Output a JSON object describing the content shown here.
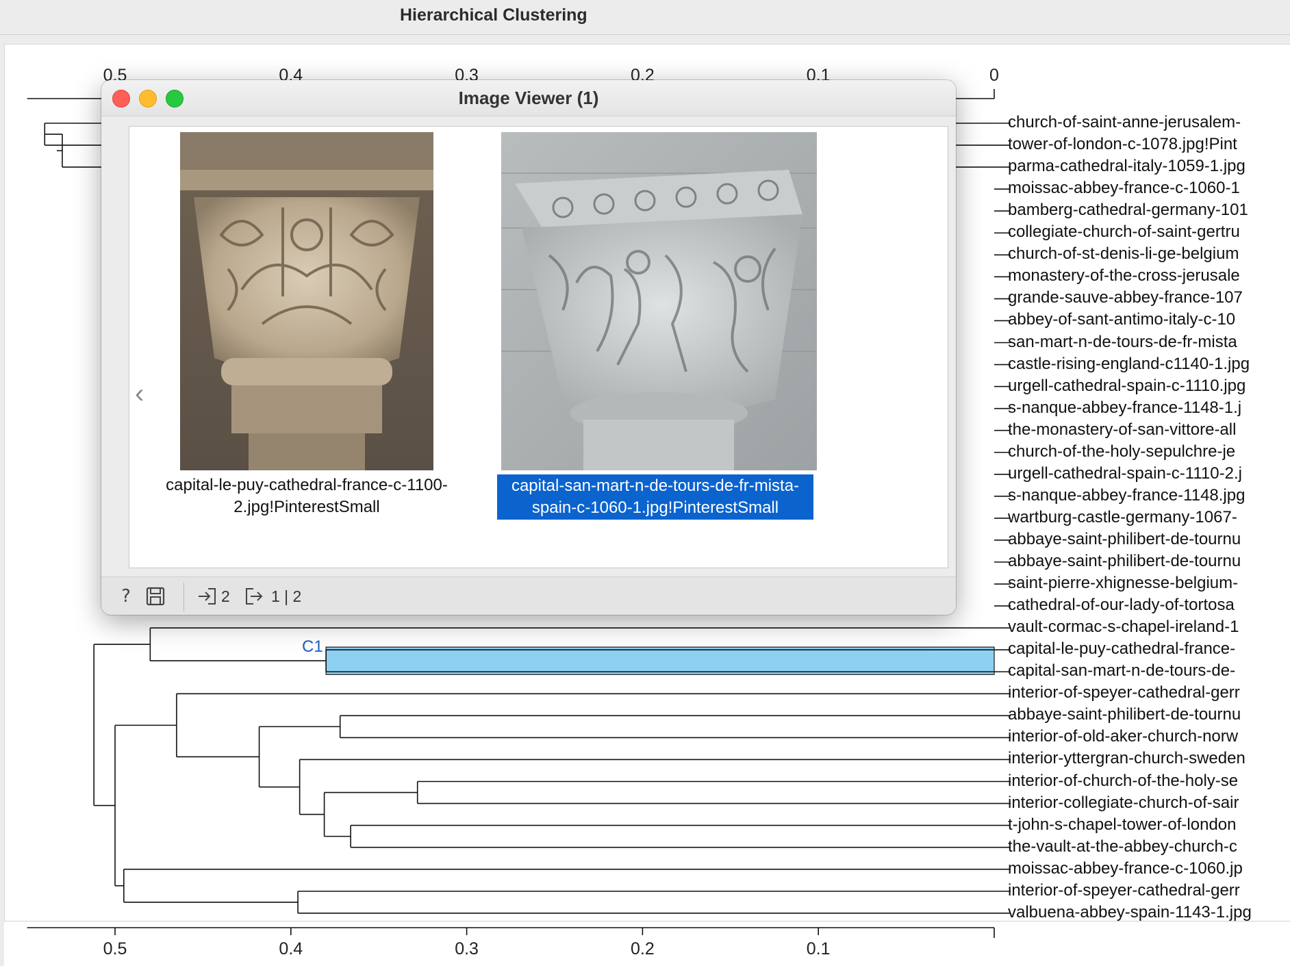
{
  "window": {
    "title": "Hierarchical Clustering"
  },
  "axis": {
    "top_ticks": [
      "0.5",
      "0.4",
      "0.3",
      "0.2",
      "0.1",
      "0"
    ],
    "bottom_ticks": [
      "0.5",
      "0.4",
      "0.3",
      "0.2",
      "0.1",
      ""
    ]
  },
  "cluster": {
    "label": "C1"
  },
  "leaves": [
    "church-of-saint-anne-jerusalem-",
    "tower-of-london-c-1078.jpg!Pint",
    "parma-cathedral-italy-1059-1.jpg",
    "moissac-abbey-france-c-1060-1",
    "bamberg-cathedral-germany-101",
    "collegiate-church-of-saint-gertru",
    "church-of-st-denis-li-ge-belgium",
    "monastery-of-the-cross-jerusale",
    "grande-sauve-abbey-france-107",
    "abbey-of-sant-antimo-italy-c-10",
    "san-mart-n-de-tours-de-fr-mista",
    "castle-rising-england-c1140-1.jpg",
    "urgell-cathedral-spain-c-1110.jpg",
    "s-nanque-abbey-france-1148-1.j",
    "the-monastery-of-san-vittore-all",
    "church-of-the-holy-sepulchre-je",
    "urgell-cathedral-spain-c-1110-2.j",
    "s-nanque-abbey-france-1148.jpg",
    "wartburg-castle-germany-1067-",
    "abbaye-saint-philibert-de-tournu",
    "abbaye-saint-philibert-de-tournu",
    "saint-pierre-xhignesse-belgium-",
    "cathedral-of-our-lady-of-tortosa",
    "vault-cormac-s-chapel-ireland-1",
    "capital-le-puy-cathedral-france-",
    "capital-san-mart-n-de-tours-de-",
    "interior-of-speyer-cathedral-gerr",
    "abbaye-saint-philibert-de-tournu",
    "interior-of-old-aker-church-norw",
    "interior-yttergran-church-sweden",
    "interior-of-church-of-the-holy-se",
    "interior-collegiate-church-of-sair",
    "t-john-s-chapel-tower-of-london",
    "the-vault-at-the-abbey-church-c",
    "moissac-abbey-france-c-1060.jp",
    "interior-of-speyer-cathedral-gerr",
    "valbuena-abbey-spain-1143-1.jpg"
  ],
  "merges": [
    {
      "a": 24,
      "b": 25,
      "h": 0.38
    },
    {
      "a": 23,
      "b": -1,
      "h": 0.48
    },
    {
      "a": 27,
      "b": 28,
      "h": 0.372
    },
    {
      "a": 30,
      "b": 31,
      "h": 0.328
    },
    {
      "a": 32,
      "b": 33,
      "h": 0.366
    },
    {
      "a": -4,
      "b": -5,
      "h": 0.381
    },
    {
      "a": 29,
      "b": -6,
      "h": 0.395
    },
    {
      "a": -3,
      "b": -7,
      "h": 0.418
    },
    {
      "a": 26,
      "b": -8,
      "h": 0.465
    },
    {
      "a": 35,
      "b": 36,
      "h": 0.396
    },
    {
      "a": 34,
      "b": -10,
      "h": 0.495
    },
    {
      "a": -9,
      "b": -11,
      "h": 0.5
    },
    {
      "a": -2,
      "b": -12,
      "h": 0.512
    },
    {
      "a": 0,
      "b": 1,
      "h": 0.54
    },
    {
      "a": 2,
      "b": -14,
      "h": 0.53
    }
  ],
  "viewer": {
    "title": "Image Viewer (1)",
    "items": [
      {
        "caption": "capital-le-puy-cathedral-france-c-1100-2.jpg!PinterestSmall",
        "selected": false
      },
      {
        "caption": "capital-san-mart-n-de-tours-de-fr-mista-spain-c-1060-1.jpg!PinterestSmall",
        "selected": true
      }
    ],
    "toolbar": {
      "in_count": "2",
      "out_count": "1 | 2"
    }
  },
  "colors": {
    "selection_blue": "#0b63ce",
    "cluster_fill": "#8ed0f2",
    "cluster_text": "#1e5fbf"
  }
}
